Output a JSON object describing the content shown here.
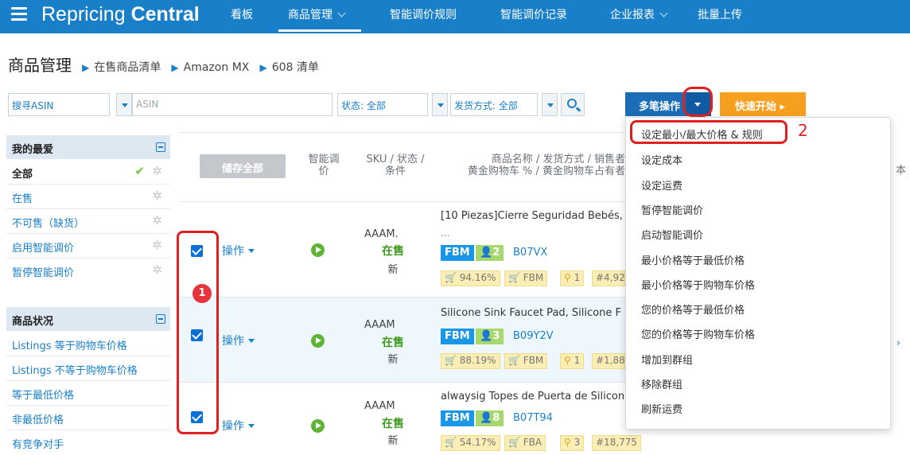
{
  "colors": {
    "topbar": "#1a7fc9",
    "primary": "#1b6db7",
    "warning": "#f79f1f",
    "success": "#5fb336",
    "highlight": "#e02020"
  },
  "header": {
    "logo_part1": "Repricing",
    "logo_part2": "Central",
    "nav": [
      "看板",
      "商品管理",
      "智能调价规则",
      "智能调价记录",
      "企业报表",
      "批量上传"
    ],
    "active_nav": "商品管理"
  },
  "breadcrumb": {
    "title": "商品管理",
    "items": [
      "在售商品清单",
      "Amazon MX",
      "608 清单"
    ]
  },
  "filters": {
    "search_type": "搜寻ASIN",
    "search_placeholder": "ASIN",
    "status": "状态: 全部",
    "fulfillment": "发货方式: 全部"
  },
  "actions": {
    "multi_label": "多笔操作",
    "quick_label": "快速开始 ▸",
    "save_all": "储存全部"
  },
  "sidebar": {
    "favorites": {
      "header": "我的最爱",
      "items": [
        "全部",
        "在售",
        "不可售（缺货）",
        "启用智能调价",
        "暂停智能调价"
      ],
      "selected": "全部"
    },
    "status": {
      "header": "商品状况",
      "items": [
        "Listings 等于购物车价格",
        "Listings 不等于购物车价格",
        "等于最低价格",
        "非最低价格",
        "有竞争对手"
      ]
    }
  },
  "table": {
    "columns": {
      "smart_line1": "智能调",
      "smart_line2": "价",
      "sku_line1": "SKU / 状态 /",
      "sku_line2": "条件",
      "name_line1": "商品名称 / 发货方式 / 销售者",
      "name_line2": "黄金购物车 % / 黄金购物车占有者",
      "cut_col": "本"
    },
    "rows": [
      {
        "checked": true,
        "op": "操作",
        "sku": "AAAM.",
        "status": "在售",
        "condition": "新",
        "title": "[10 Piezas]Cierre Seguridad Bebés,",
        "ellipsis": "...",
        "channel": "FBM",
        "offers": "2",
        "asin": "B07VX",
        "buybox": "94.16%",
        "buybox_channel": "FBM",
        "sellers": "1",
        "rank": "#4,92"
      },
      {
        "checked": true,
        "op": "操作",
        "sku": "AAAM",
        "status": "在售",
        "condition": "新",
        "title": "Silicone Sink Faucet Pad, Silicone F",
        "channel": "FBM",
        "offers": "3",
        "asin": "B09Y2V",
        "buybox": "88.19%",
        "buybox_channel": "FBM",
        "sellers": "1",
        "rank": "#1,88"
      },
      {
        "checked": true,
        "op": "操作",
        "sku": "AAAM",
        "status": "在售",
        "condition": "新",
        "title": "alwaysig Topes de Puerta de Silicon",
        "channel": "FBM",
        "offers": "8",
        "asin": "B07T94",
        "buybox": "54.17%",
        "buybox_channel": "FBA",
        "sellers": "3",
        "rank": "#18,775"
      }
    ]
  },
  "dropdown_menu": {
    "items": [
      "设定最小/最大价格 & 规则",
      "设定成本",
      "设定运费",
      "暂停智能调价",
      "启动智能调价",
      "最小价格等于最低价格",
      "最小价格等于购物车价格",
      "您的价格等于最低价格",
      "您的价格等于购物车价格",
      "增加到群组",
      "移除群组",
      "刷新运费"
    ]
  },
  "annotations": {
    "step1": "1",
    "step2": "2"
  }
}
